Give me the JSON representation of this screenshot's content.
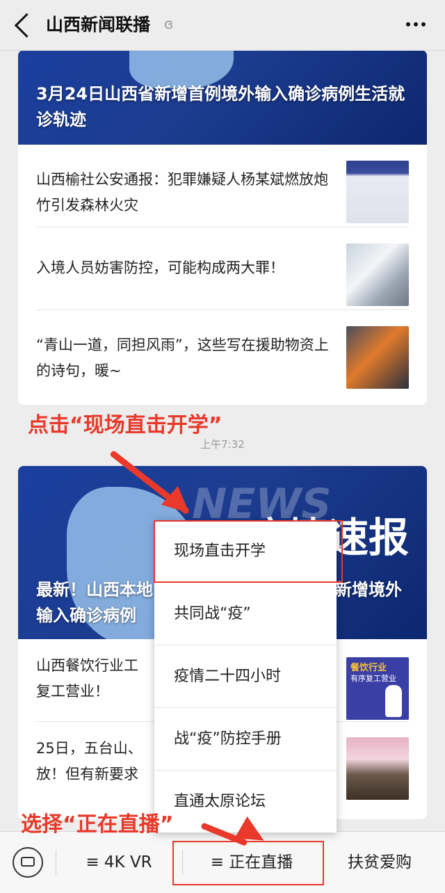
{
  "header": {
    "title": "山西新闻联播"
  },
  "card1": {
    "headline": "3月24日山西省新增首例境外输入确诊病例生活就诊轨迹",
    "items": [
      {
        "text": "山西榆社公安通报：犯罪嫌疑人杨某斌燃放炮竹引发森林火灾"
      },
      {
        "text": "入境人员妨害防控，可能构成两大罪！"
      },
      {
        "text": "“青山一道，同担风雨”，这些写在援助物资上的诗句，暖~"
      }
    ]
  },
  "timestamp": "上午7:32",
  "card2": {
    "hero_banner": "疫情速报",
    "hero_news": "NEWS",
    "headline_left": "最新！山西本地",
    "headline_right": "新增境外",
    "headline_line2": "输入确诊病例",
    "items": [
      {
        "line1": "山西餐饮行业工",
        "line2": "复工营业！"
      },
      {
        "line1": "25日，五台山、",
        "line2": "放！但有新要求"
      }
    ],
    "thumb1_badge": "餐饮行业",
    "thumb1_sub": "有序复工营业"
  },
  "annotations": {
    "top": "点击“现场直击开学”",
    "bottom": "选择“正在直播”"
  },
  "menu": {
    "items": [
      "现场直击开学",
      "共同战“疫”",
      "疫情二十四小时",
      "战“疫”防控手册",
      "直通太原论坛"
    ]
  },
  "bottom_tabs": [
    "≡ 4K VR",
    "≡ 正在直播",
    "扶贫爱购"
  ],
  "colors": {
    "accent_red": "#e8392a",
    "hero_blue": "#1c3c8f"
  }
}
